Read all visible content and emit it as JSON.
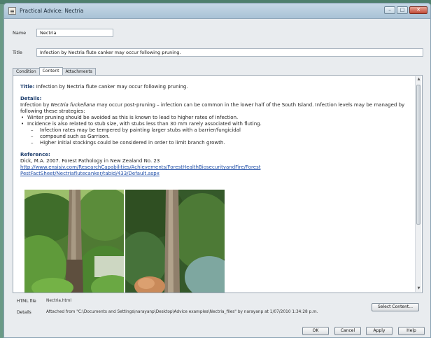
{
  "window": {
    "title": "Practical Advice: Nectria"
  },
  "form": {
    "name_label": "Name",
    "name_value": "Nectria",
    "title_label": "Title",
    "title_value": "Infection by Nectria flute canker may occur following pruning."
  },
  "tabs": [
    {
      "label": "Condition",
      "active": false
    },
    {
      "label": "Content",
      "active": true
    },
    {
      "label": "Attachments",
      "active": false
    }
  ],
  "content": {
    "title_label": "Title:",
    "title_text": " Infection by Nectria flute canker may occur following pruning.",
    "details_heading": "Details:",
    "details_pre": "Infection by ",
    "details_species": "Nectria fuckeliana",
    "details_post": " may occur post-pruning – infection can be common in the lower half of the South Island. Infection levels may be managed by following these strategies:",
    "bullets": [
      "Winter pruning should be avoided as this is known to lead to higher rates of infection.",
      "Incidence is also related to stub size, with stubs less than 30 mm rarely associated with fluting."
    ],
    "sub_bullets": [
      "Infection rates may be tempered by painting larger stubs with a barrier/fungicidal",
      "compound such as Garrison.",
      "Higher initial stockings could be considered in order to limit branch growth."
    ],
    "reference_heading": "Reference:",
    "reference_text": "Dick, M.A. 2007. Forest Pathology in New Zealand No. 23",
    "reference_link_1": "http://www.ensisjv.com/ResearchCapabilities/Achievements/ForestHealthBiosecurityandFire/Forest",
    "reference_link_2": "PestFactSheet/Nectriaflutecanker/tabid/433/Default.aspx"
  },
  "footer": {
    "html_file_label": "HTML file",
    "html_file_value": "Nectria.html",
    "details_label": "Details",
    "details_value": "Attached from \"C:\\Documents and Settings\\narayanp\\Desktop\\Advice examples\\Nectria_files\" by narayanp at 1/07/2010 1:34:28 p.m.",
    "select_content_label": "Select Content..."
  },
  "buttons": {
    "ok": "OK",
    "cancel": "Cancel",
    "apply": "Apply",
    "help": "Help"
  },
  "icons": {
    "window": "document-icon",
    "minimize": "minimize-icon",
    "maximize": "maximize-icon",
    "close": "close-icon"
  }
}
